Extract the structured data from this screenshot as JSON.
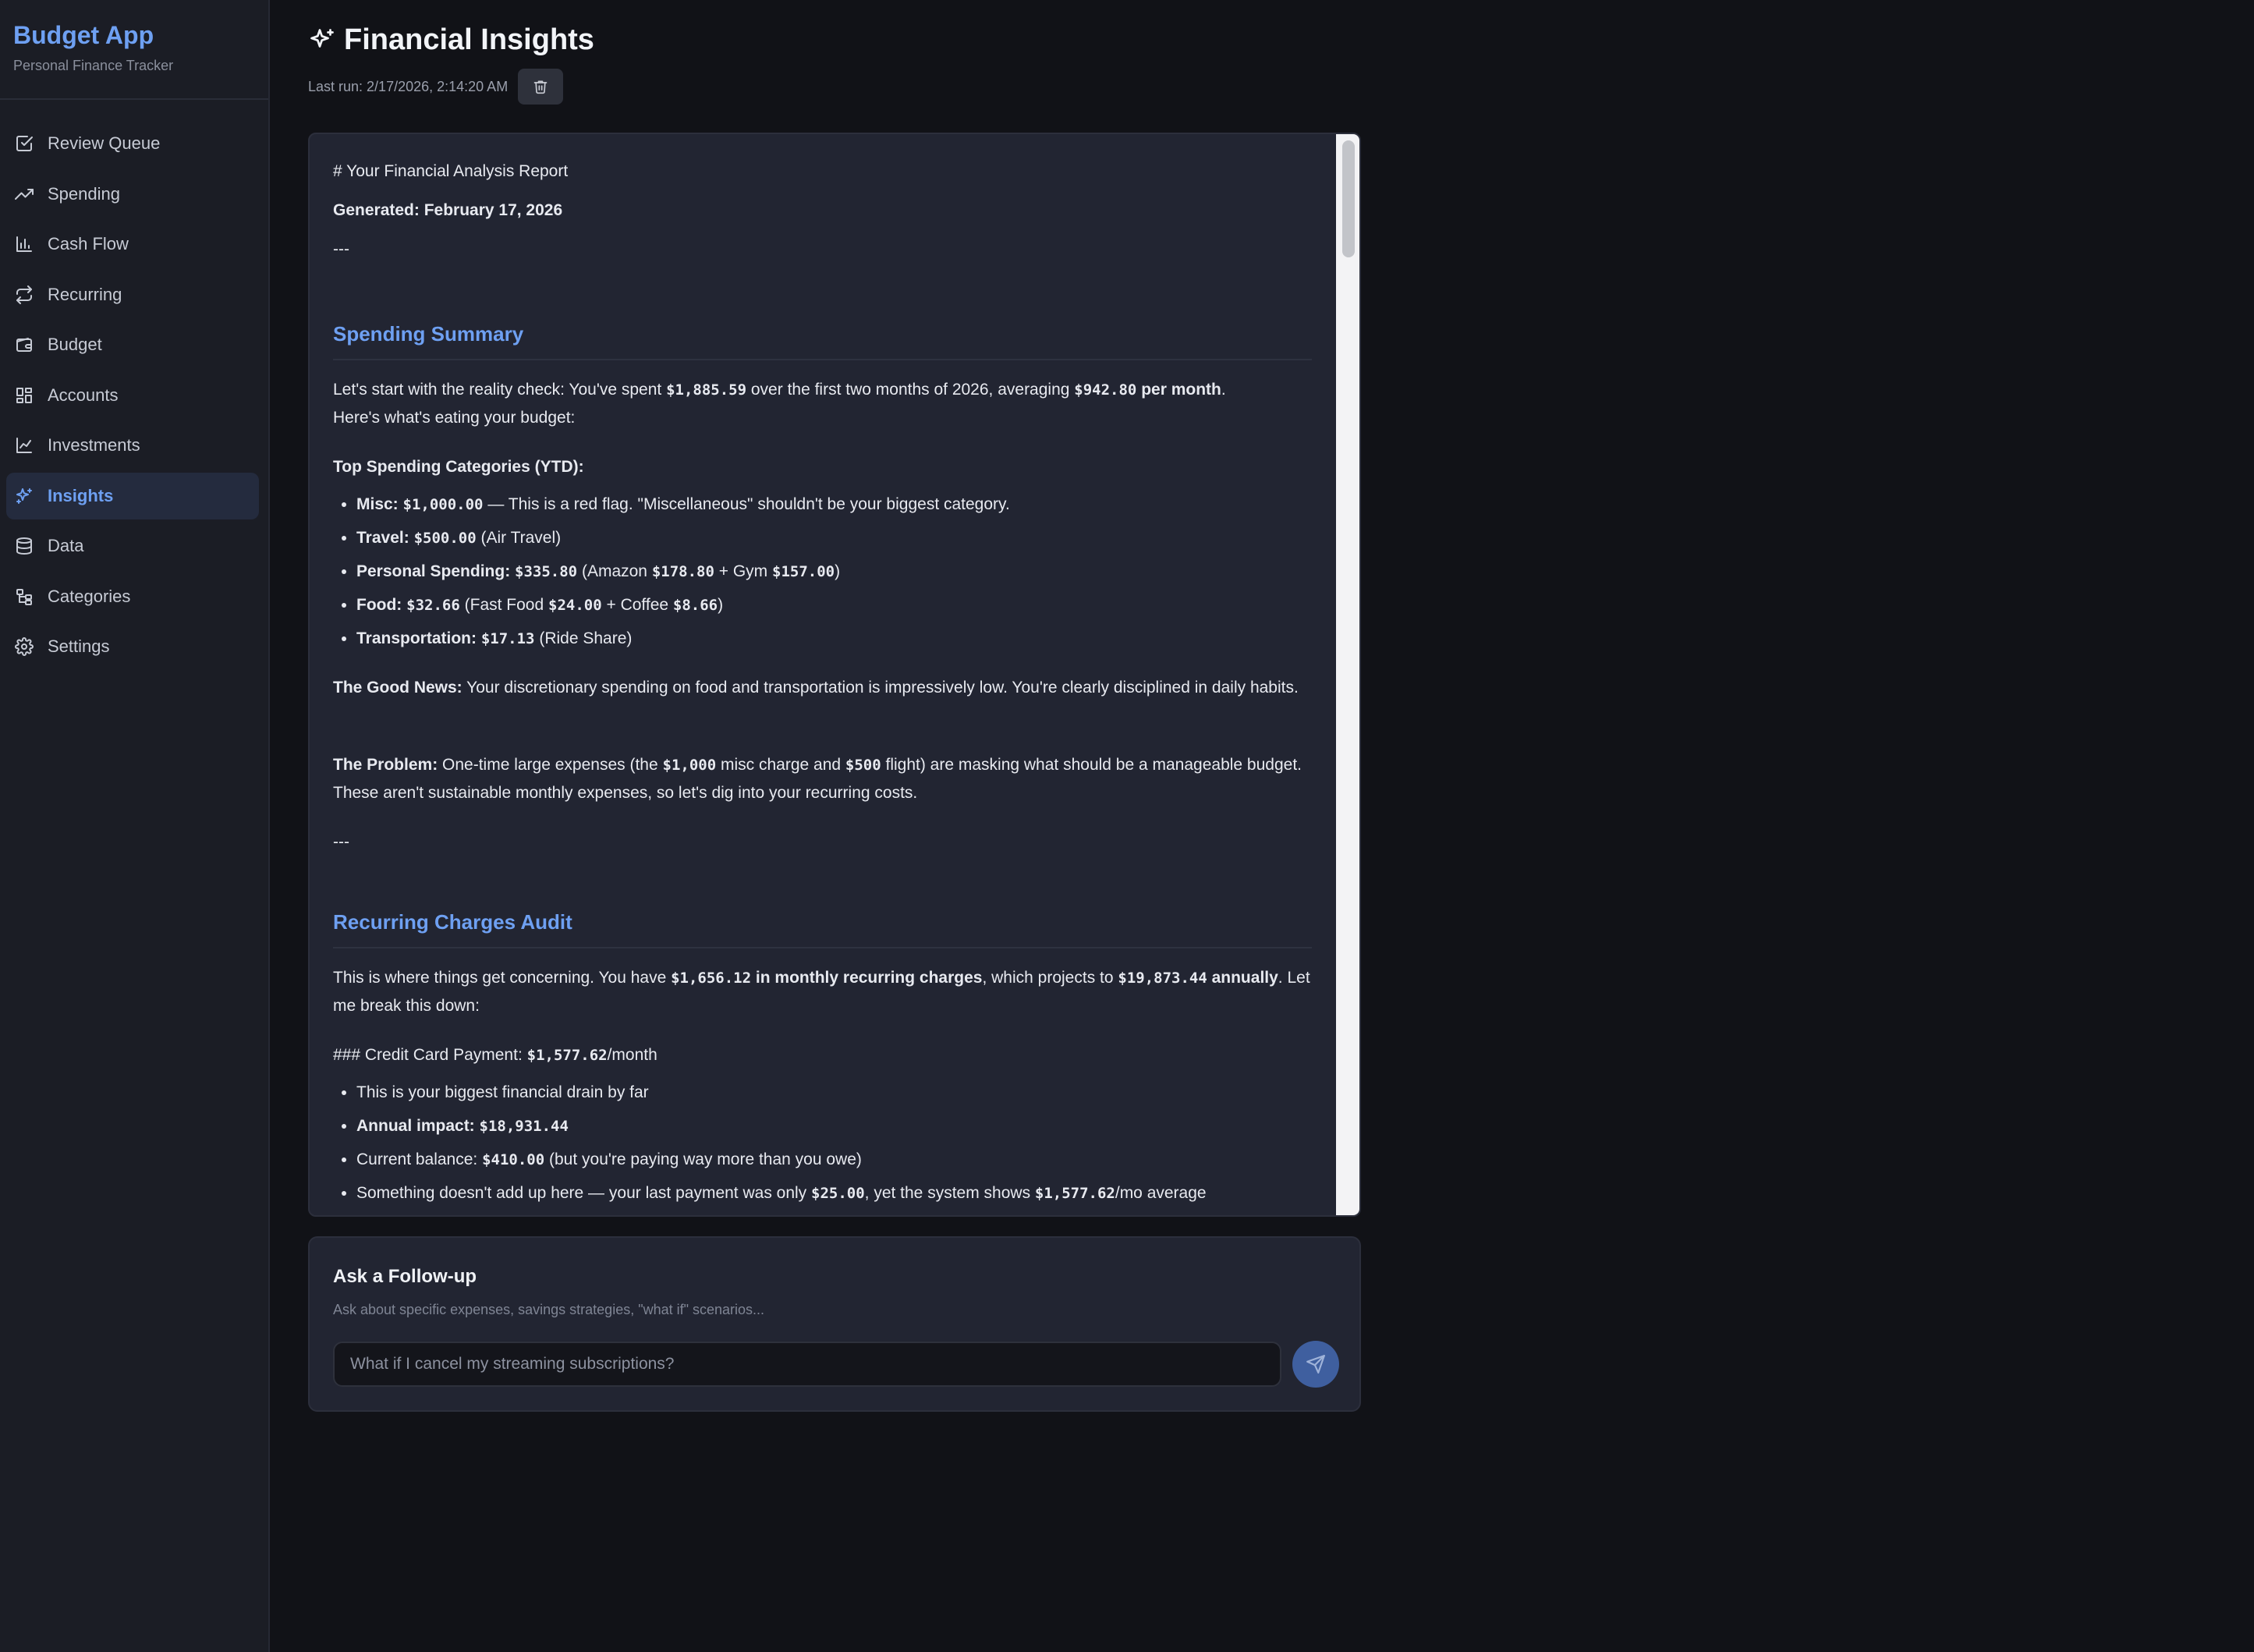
{
  "app": {
    "title": "Budget App",
    "subtitle": "Personal Finance Tracker"
  },
  "sidebar": {
    "items": [
      {
        "label": "Review Queue",
        "icon": "check-square-icon"
      },
      {
        "label": "Spending",
        "icon": "trending-up-icon"
      },
      {
        "label": "Cash Flow",
        "icon": "bar-chart-icon"
      },
      {
        "label": "Recurring",
        "icon": "repeat-icon"
      },
      {
        "label": "Budget",
        "icon": "wallet-icon"
      },
      {
        "label": "Accounts",
        "icon": "grid-icon"
      },
      {
        "label": "Investments",
        "icon": "line-chart-icon"
      },
      {
        "label": "Insights",
        "icon": "sparkles-icon",
        "active": true
      },
      {
        "label": "Data",
        "icon": "database-icon"
      },
      {
        "label": "Categories",
        "icon": "tree-icon"
      },
      {
        "label": "Settings",
        "icon": "gear-icon"
      }
    ]
  },
  "header": {
    "title": "Financial Insights",
    "last_run": "Last run: 2/17/2026, 2:14:20 AM",
    "icon": "sparkles-icon"
  },
  "report": {
    "heading_line": "# Your Financial Analysis Report",
    "generated_label": "Generated: February 17, 2026",
    "rule": "---",
    "spending": {
      "title": "Spending Summary",
      "intro_a": "Let's start with the reality check: You've spent ",
      "intro_total": "$1,885.59",
      "intro_b": " over the first two months of 2026, averaging ",
      "intro_avg": "$942.80",
      "intro_c": " per month",
      "intro_d": ".",
      "intro_e": "Here's what's eating your budget:",
      "top_label": "Top Spending Categories (YTD):",
      "cats": {
        "misc_label": "Misc:",
        "misc_value": "$1,000.00",
        "misc_note": " — This is a red flag. \"Miscellaneous\" shouldn't be your biggest category.",
        "travel_label": "Travel:",
        "travel_value": "$500.00",
        "travel_note": " (Air Travel)",
        "personal_label": "Personal Spending:",
        "personal_value": "$335.80",
        "personal_note_a": " (Amazon ",
        "personal_amazon": "$178.80",
        "personal_note_b": " + Gym ",
        "personal_gym": "$157.00",
        "personal_note_c": ")",
        "food_label": "Food:",
        "food_value": "$32.66",
        "food_note_a": " (Fast Food ",
        "food_fast": "$24.00",
        "food_note_b": " + Coffee ",
        "food_coffee": "$8.66",
        "food_note_c": ")",
        "transport_label": "Transportation:",
        "transport_value": "$17.13",
        "transport_note": " (Ride Share)"
      },
      "good_label": "The Good News:",
      "good_text": " Your discretionary spending on food and transportation is impressively low. You're clearly disciplined in daily habits.",
      "problem_label": "The Problem:",
      "problem_a": " One-time large expenses (the ",
      "problem_v1": "$1,000",
      "problem_b": " misc charge and ",
      "problem_v2": "$500",
      "problem_c": " flight) are masking what should be a manageable budget. These aren't sustainable monthly expenses, so let's dig into your recurring costs."
    },
    "recurring": {
      "title": "Recurring Charges Audit",
      "intro_a": "This is where things get concerning. You have ",
      "intro_v1": "$1,656.12",
      "intro_b": " in monthly recurring charges",
      "intro_c": ", which projects to ",
      "intro_v2": "$19,873.44",
      "intro_d": " annually",
      "intro_e": ". Let me break this down:",
      "cc_a": "### Credit Card Payment: ",
      "cc_v": "$1,577.62",
      "cc_b": "/month",
      "b1": "This is your biggest financial drain by far",
      "b2_label": "Annual impact:",
      "b2_value": "$18,931.44",
      "b3_a": "Current balance: ",
      "b3_value": "$410.00",
      "b3_b": " (but you're paying way more than you owe)",
      "b4_a": "Something doesn't add up here — your last payment was only ",
      "b4_v1": "$25.00",
      "b4_b": ", yet the system shows ",
      "b4_v2": "$1,577.62",
      "b4_c": "/mo average"
    }
  },
  "followup": {
    "title": "Ask a Follow-up",
    "subtitle": "Ask about specific expenses, savings strategies, \"what if\" scenarios...",
    "placeholder": "What if I cancel my streaming subscriptions?",
    "send_icon": "send-icon"
  },
  "colors": {
    "accent": "#6ea0f2",
    "background": "#111217",
    "sidebar": "#1b1d25",
    "panel": "#222532"
  }
}
